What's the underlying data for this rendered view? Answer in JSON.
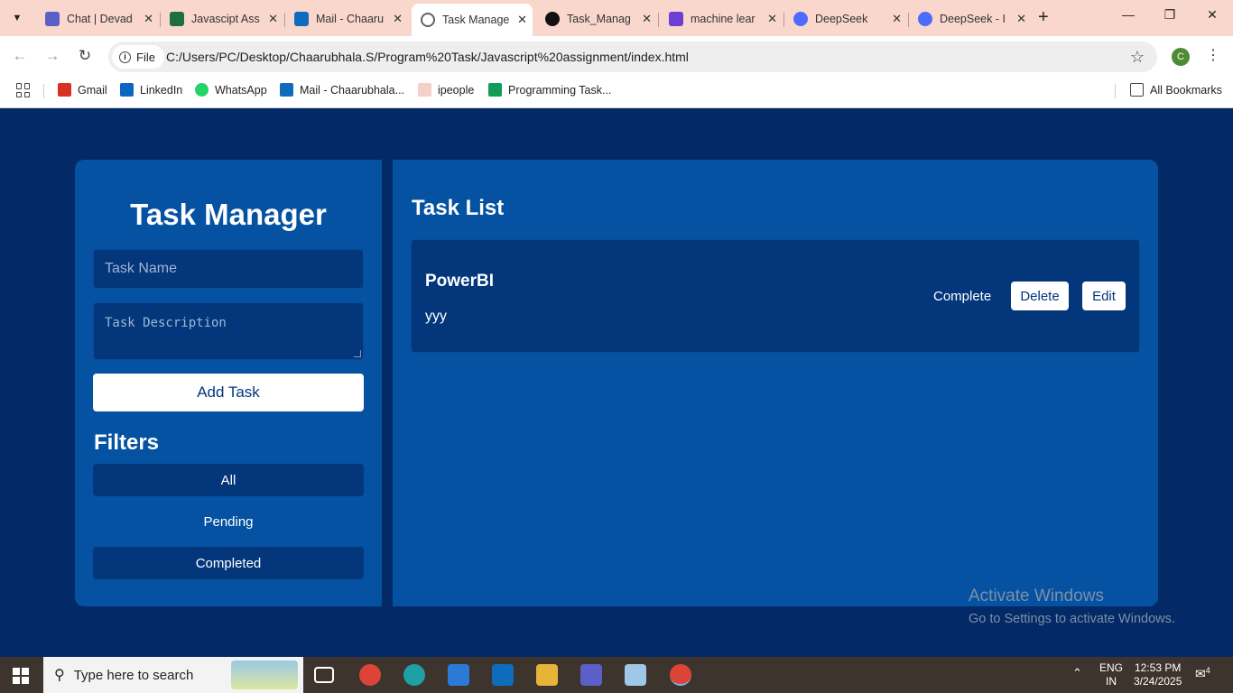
{
  "browser": {
    "tabs": [
      {
        "label": "Chat | Devad",
        "icon": "teams-icon",
        "color": "#5b5fc7"
      },
      {
        "label": "Javascipt Ass",
        "icon": "excel-icon",
        "color": "#1d6f42"
      },
      {
        "label": "Mail - Chaaru",
        "icon": "outlook-icon",
        "color": "#0f6cbd"
      },
      {
        "label": "Task Manage",
        "icon": "globe-icon",
        "color": "#5f6368"
      },
      {
        "label": "Task_Manag",
        "icon": "github-icon",
        "color": "#111111"
      },
      {
        "label": "machine lear",
        "icon": "ai-icon",
        "color": "#6a3fd1"
      },
      {
        "label": "DeepSeek",
        "icon": "deepseek-icon",
        "color": "#4d6bfe"
      },
      {
        "label": "DeepSeek - I",
        "icon": "deepseek-icon",
        "color": "#4d6bfe"
      }
    ],
    "address": {
      "chip": "File",
      "url": "C:/Users/PC/Desktop/Chaarubhala.S/Program%20Task/Javascript%20assignment/index.html"
    },
    "profile_initial": "C",
    "bookmarks": [
      {
        "label": "Gmail",
        "color": "#d93025"
      },
      {
        "label": "LinkedIn",
        "color": "#0a66c2"
      },
      {
        "label": "WhatsApp",
        "color": "#25d366"
      },
      {
        "label": "Mail - Chaarubhala...",
        "color": "#0f6cbd"
      },
      {
        "label": "ipeople",
        "color": "#c0392b"
      },
      {
        "label": "Programming Task...",
        "color": "#0f9d58"
      }
    ],
    "all_bookmarks": "All Bookmarks"
  },
  "app": {
    "title": "Task Manager",
    "task_name_placeholder": "Task Name",
    "task_desc_placeholder": "Task Description",
    "add_button": "Add Task",
    "filters_title": "Filters",
    "filters": [
      "All",
      "Pending",
      "Completed"
    ],
    "list_title": "Task List",
    "tasks": [
      {
        "name": "PowerBI",
        "description": "yyy",
        "complete_label": "Complete",
        "delete_label": "Delete",
        "edit_label": "Edit"
      }
    ]
  },
  "watermark": {
    "line1": "Activate Windows",
    "line2": "Go to Settings to activate Windows."
  },
  "taskbar": {
    "search_text": "Type here to search",
    "lang_1": "ENG",
    "lang_2": "IN",
    "time": "12:53 PM",
    "date": "3/24/2025",
    "notification_count": "4"
  },
  "colors": {
    "page_bg": "#032a66",
    "panel": "#0452a1",
    "card": "#03367a",
    "accent_text": "#03367a"
  }
}
